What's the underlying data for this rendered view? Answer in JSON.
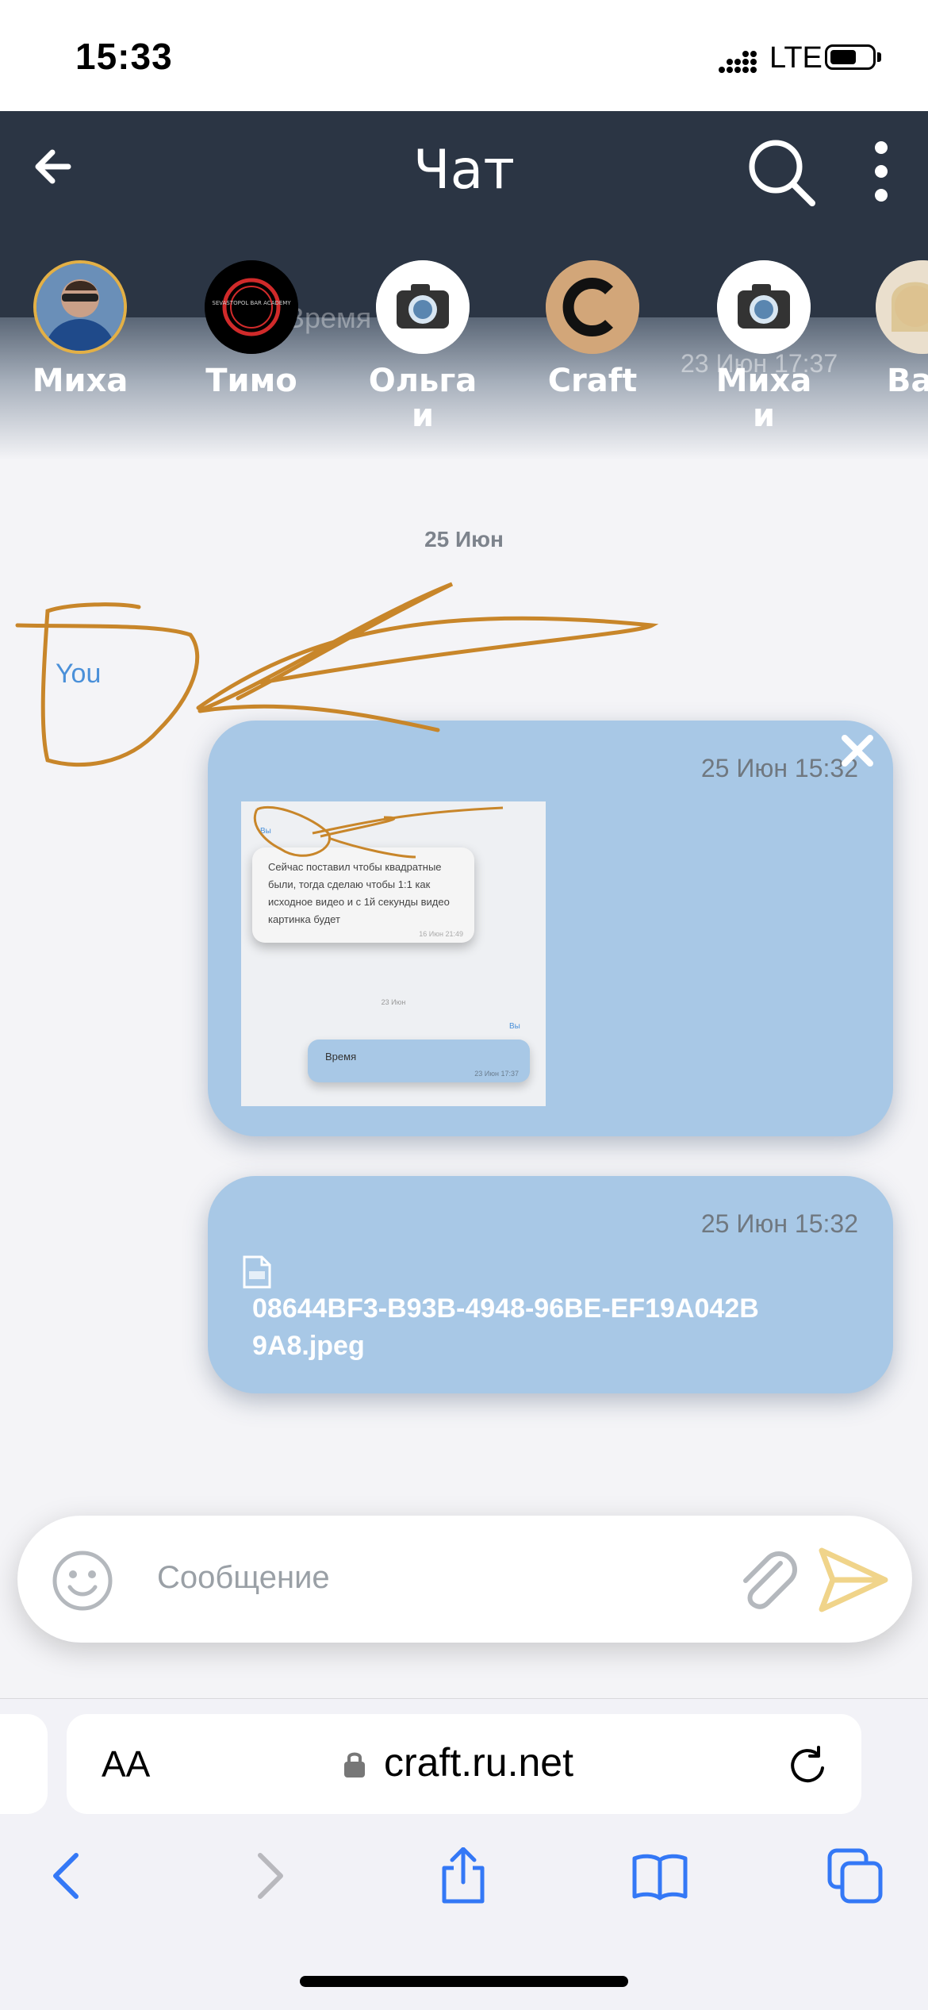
{
  "status_bar": {
    "time": "15:33",
    "network": "LTE"
  },
  "header": {
    "title": "Чат"
  },
  "ghost_message": {
    "text": "Время",
    "time": "23 Июн 17:37"
  },
  "stories": [
    {
      "name": "Миха"
    },
    {
      "name": "Тимо",
      "logo_text": "SEVASTOPOL BAR ACADEMY"
    },
    {
      "name": "Ольга\nи"
    },
    {
      "name": "Craft"
    },
    {
      "name": "Миха\nи"
    },
    {
      "name": "Ва"
    }
  ],
  "chat": {
    "date_divider": "25 Июн",
    "sender": "You",
    "messages": [
      {
        "time": "25 Июн 15:32",
        "close_glyph": "×",
        "preview": {
          "sender": "Вы",
          "text": "Сейчас поставил чтобы квадратные были, тогда сделаю чтобы 1:1 как исходное видео и с 1й секунды видео картинка будет",
          "text_time": "16 Июн 21:49",
          "date": "23 Июн",
          "reply_sender": "Вы",
          "reply_text": "Время",
          "reply_time": "23 Июн 17:37"
        }
      },
      {
        "time": "25 Июн 15:32",
        "file_name": "08644BF3-B93B-4948-96BE-EF19A042B9A8.jpeg"
      }
    ]
  },
  "composer": {
    "placeholder": "Сообщение"
  },
  "browser": {
    "text_size_label": "AA",
    "url": "craft.ru.net"
  },
  "colors": {
    "header_bg": "#2b3544",
    "bubble_bg": "#a8c8e6",
    "accent_link": "#4a90d9",
    "annotation": "#c8862a",
    "send_icon": "#f0d48a",
    "ios_blue": "#3478f6"
  },
  "icons": [
    "back-arrow-icon",
    "search-icon",
    "more-vertical-icon",
    "close-icon",
    "file-icon",
    "emoji-icon",
    "paperclip-icon",
    "send-icon",
    "lock-icon",
    "reload-icon",
    "nav-back-icon",
    "nav-forward-icon",
    "share-icon",
    "bookmarks-icon",
    "tabs-icon"
  ]
}
